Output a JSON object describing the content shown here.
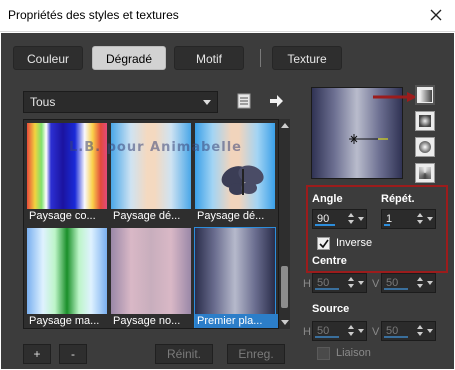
{
  "window": {
    "title": "Propriétés des styles et textures"
  },
  "tabs": [
    {
      "label": "Couleur",
      "active": false
    },
    {
      "label": "Dégradé",
      "active": true
    },
    {
      "label": "Motif",
      "active": false
    },
    {
      "label": "Texture",
      "active": false
    }
  ],
  "category": {
    "value": "Tous"
  },
  "watermark": "L.B. pour Animabelle",
  "gradients": [
    {
      "caption": "Paysage co..."
    },
    {
      "caption": "Paysage dé..."
    },
    {
      "caption": "Paysage dé..."
    },
    {
      "caption": "Paysage ma..."
    },
    {
      "caption": "Paysage no..."
    },
    {
      "caption": "Premier pla...",
      "selected": true
    }
  ],
  "buttons": {
    "add": "+",
    "remove": "-",
    "reset": "Réinit.",
    "save": "Enreg."
  },
  "settings": {
    "angle_label": "Angle",
    "angle_value": "90",
    "repeat_label": "Répét.",
    "repeat_value": "1",
    "invert_label": "Inverse",
    "invert_checked": true,
    "centre_label": "Centre",
    "centre_h_label": "H",
    "centre_h_value": "50",
    "centre_v_label": "V",
    "centre_v_value": "50",
    "source_label": "Source",
    "source_h_label": "H",
    "source_h_value": "50",
    "source_v_label": "V",
    "source_v_value": "50",
    "link_label": "Liaison"
  },
  "colors": {
    "accent": "#2c8ddb",
    "highlight_box": "#9c1c1c",
    "background": "#3c3c3c"
  }
}
